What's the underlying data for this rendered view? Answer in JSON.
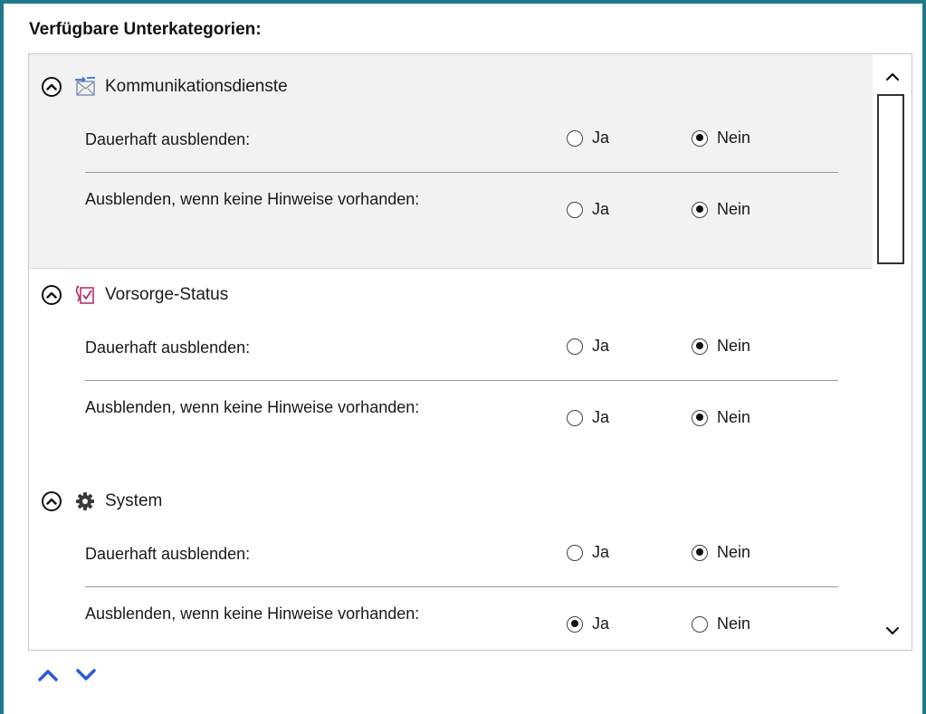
{
  "panel": {
    "title": "Verfügbare Unterkategorien:"
  },
  "option_labels": {
    "yes": "Ja",
    "no": "Nein"
  },
  "categories": [
    {
      "label": "Kommunikationsdienste",
      "icon": "communication-icon",
      "selected": true,
      "settings": [
        {
          "label": "Dauerhaft ausblenden:",
          "value": "Nein"
        },
        {
          "label": "Ausblenden, wenn keine Hinweise vorhanden:",
          "value": "Nein"
        }
      ]
    },
    {
      "label": "Vorsorge-Status",
      "icon": "prevention-status-icon",
      "selected": false,
      "settings": [
        {
          "label": "Dauerhaft ausblenden:",
          "value": "Nein"
        },
        {
          "label": "Ausblenden, wenn keine Hinweise vorhanden:",
          "value": "Nein"
        }
      ]
    },
    {
      "label": "System",
      "icon": "gear-icon",
      "selected": false,
      "settings": [
        {
          "label": "Dauerhaft ausblenden:",
          "value": "Nein"
        },
        {
          "label": "Ausblenden, wenn keine Hinweise vorhanden:",
          "value": "Ja"
        }
      ]
    }
  ],
  "colors": {
    "accent_border": "#1e7a8a",
    "move_arrows": "#2a5bd7",
    "selected_bg": "#f2f2f2"
  }
}
